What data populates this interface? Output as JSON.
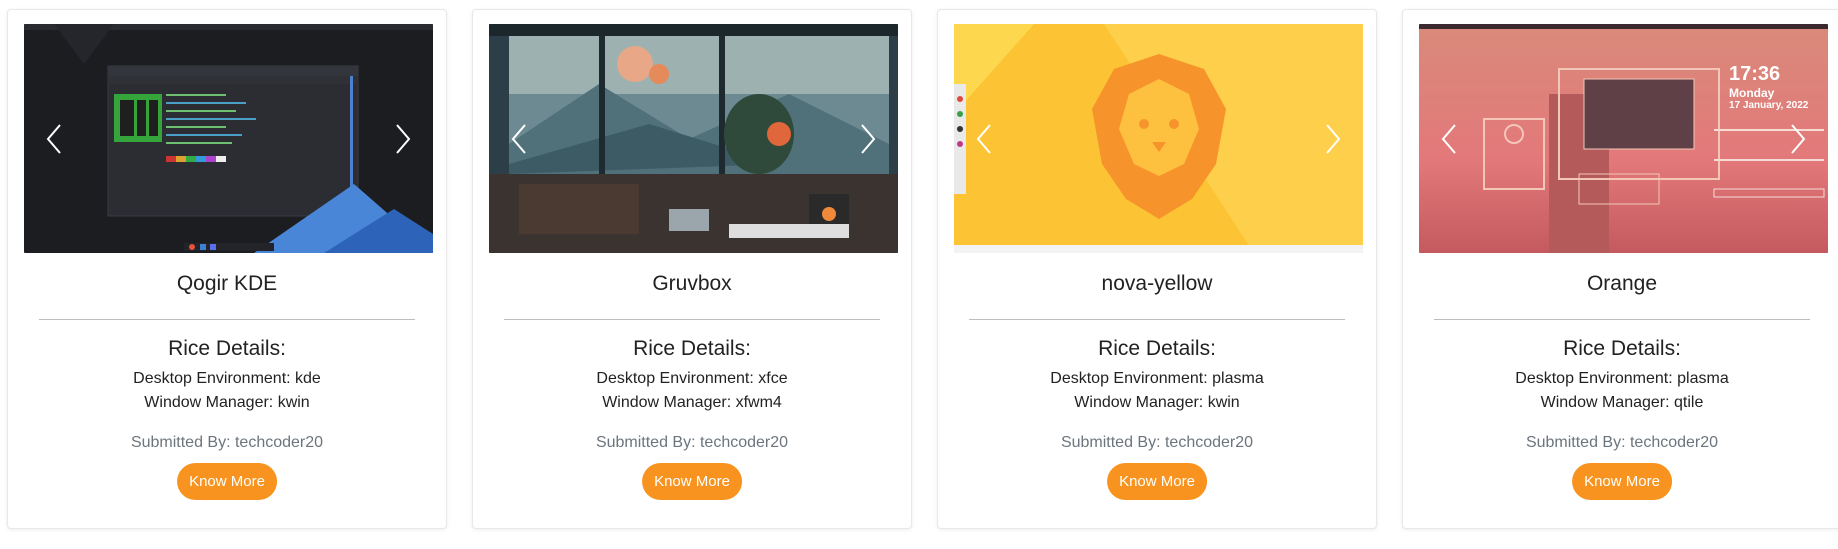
{
  "cards": [
    {
      "screenshot_icon": "kde-desktop-screenshot",
      "title": "Qogir KDE",
      "details_heading": "Rice Details:",
      "desktop_environment": "Desktop Environment: kde",
      "window_manager": "Window Manager: kwin",
      "submitted_by": "Submitted By: techcoder20",
      "button_label": "Know More"
    },
    {
      "screenshot_icon": "lofi-room-wallpaper",
      "title": "Gruvbox",
      "details_heading": "Rice Details:",
      "desktop_environment": "Desktop Environment: xfce",
      "window_manager": "Window Manager: xfwm4",
      "submitted_by": "Submitted By: techcoder20",
      "button_label": "Know More"
    },
    {
      "screenshot_icon": "lion-logo-wallpaper",
      "title": "nova-yellow",
      "details_heading": "Rice Details:",
      "desktop_environment": "Desktop Environment: plasma",
      "window_manager": "Window Manager: kwin",
      "submitted_by": "Submitted By: techcoder20",
      "button_label": "Know More"
    },
    {
      "screenshot_icon": "sunset-desktop-screenshot",
      "title": "Orange",
      "details_heading": "Rice Details:",
      "desktop_environment": "Desktop Environment: plasma",
      "window_manager": "Window Manager: qtile",
      "submitted_by": "Submitted By: techcoder20",
      "button_label": "Know More",
      "clock_time": "17:36",
      "clock_day": "Monday",
      "clock_date": "17 January, 2022"
    }
  ],
  "carousel_controls": {
    "prev_icon": "chevron-left-icon",
    "next_icon": "chevron-right-icon"
  },
  "colors": {
    "accent": "#f7931e",
    "muted_text": "#6c757d",
    "divider": "#bdbdbd"
  }
}
